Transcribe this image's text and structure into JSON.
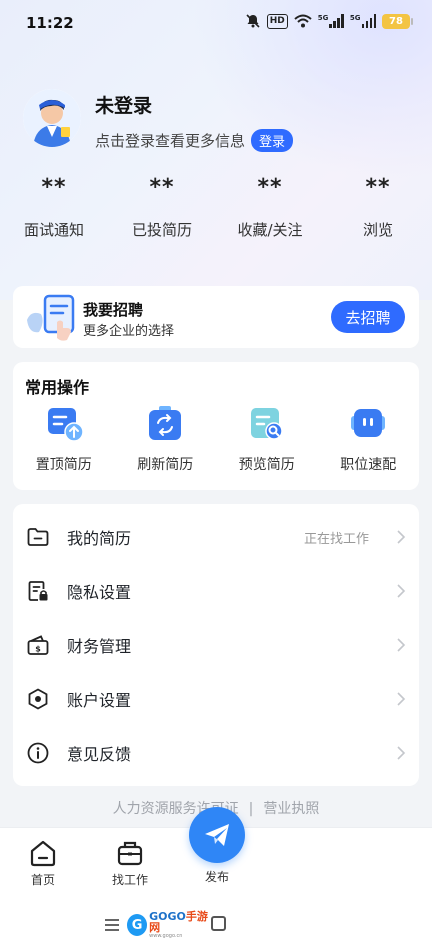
{
  "status_bar": {
    "time": "11:22",
    "hd_label": "HD",
    "net1": "5G",
    "net2": "5G",
    "battery": "78"
  },
  "profile": {
    "name": "未登录",
    "hint": "点击登录查看更多信息",
    "login_button": "登录"
  },
  "stats": [
    {
      "value": "**",
      "label": "面试通知"
    },
    {
      "value": "**",
      "label": "已投简历"
    },
    {
      "value": "**",
      "label": "收藏/关注"
    },
    {
      "value": "**",
      "label": "浏览"
    }
  ],
  "recruit_banner": {
    "title": "我要招聘",
    "subtitle": "更多企业的选择",
    "button": "去招聘"
  },
  "common_ops": {
    "title": "常用操作",
    "items": [
      {
        "label": "置顶简历",
        "icon": "resume-top-icon"
      },
      {
        "label": "刷新简历",
        "icon": "refresh-resume-icon"
      },
      {
        "label": "预览简历",
        "icon": "preview-resume-icon"
      },
      {
        "label": "职位速配",
        "icon": "job-match-icon"
      }
    ]
  },
  "menu": [
    {
      "label": "我的简历",
      "value": "正在找工作",
      "icon": "folder-icon"
    },
    {
      "label": "隐私设置",
      "value": "",
      "icon": "privacy-lock-icon"
    },
    {
      "label": "财务管理",
      "value": "",
      "icon": "wallet-icon"
    },
    {
      "label": "账户设置",
      "value": "",
      "icon": "hexagon-settings-icon"
    },
    {
      "label": "意见反馈",
      "value": "",
      "icon": "info-icon"
    }
  ],
  "footer_links": {
    "license": "人力资源服务许可证",
    "separator": "|",
    "business": "营业执照"
  },
  "tabbar": {
    "home": "首页",
    "jobs": "找工作",
    "publish": "发布"
  },
  "watermark": {
    "brand_go": "GOGO",
    "brand_cn": "手游网",
    "site": "www.gogo.cn"
  },
  "colors": {
    "accent": "#2f6bff",
    "publish": "#2f86f6",
    "battery": "#f3c443"
  }
}
